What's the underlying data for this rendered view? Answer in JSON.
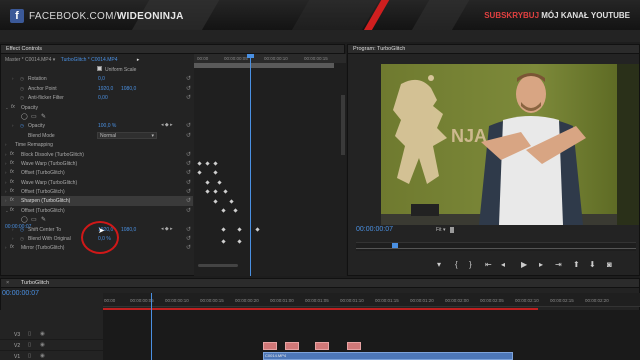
{
  "banner": {
    "fb_prefix": "FACEBOOK.COM/",
    "fb_handle": "WIDEONINJA",
    "yt_strong": "SUBSKRYBUJ",
    "yt_rest": " MÓJ KANAŁ YOUTUBE"
  },
  "effect_controls": {
    "tab_label": "Effect Controls",
    "source_master": "Master * C0014.MP4",
    "source_sequence": "TurboGlitch * C0014.MP4",
    "uniform_scale": "Uniform Scale",
    "timecode": "00:00:00:07",
    "ruler_labels": [
      "00:00",
      "00:00:00:05",
      "00:00:00:10",
      "00:00:00:15"
    ],
    "rows": [
      {
        "label": "Rotation",
        "value": "0,0"
      },
      {
        "label": "Anchor Point",
        "value": "1920,0",
        "value2": "1080,0"
      },
      {
        "label": "Anti-flicker Filter",
        "value": "0,00"
      },
      {
        "label": "Opacity"
      },
      {
        "label": "Opacity",
        "value": "100,0 %"
      },
      {
        "label": "Blend Mode",
        "value": "Normal"
      },
      {
        "label": "Time Remapping"
      },
      {
        "label": "Block Dissolve (TurboGlitch)"
      },
      {
        "label": "Wave Warp (TurboGlitch)"
      },
      {
        "label": "Offset (TurboGlitch)"
      },
      {
        "label": "Wave Warp (TurboGlitch)"
      },
      {
        "label": "Offset (TurboGlitch)"
      },
      {
        "label": "Sharpen (TurboGlitch)"
      },
      {
        "label": "Offset (TurboGlitch)"
      },
      {
        "label": "Shift Center To",
        "value": "1920,0",
        "value2": "1080,0"
      },
      {
        "label": "Blend With Original",
        "value": "0,0 %"
      },
      {
        "label": "Mirror (TurboGlitch)"
      }
    ]
  },
  "program_monitor": {
    "tab_label": "Program: TurboGlitch",
    "timecode": "00:00:00:07",
    "zoom": "Fit",
    "poster_text": "NJA"
  },
  "timeline": {
    "sequence_name": "TurboGlitch",
    "timecode": "00:00:00:07",
    "ruler_labels": [
      "00:00",
      "00:00:00:05",
      "00:00:00:10",
      "00:00:00:15",
      "00:00:00:20",
      "00:00:01:00",
      "00:00:01:05",
      "00:00:01:10",
      "00:00:01:15",
      "00:00:01:20",
      "00:00:02:00",
      "00:00:02:05",
      "00:00:02:10",
      "00:00:02:15",
      "00:00:02:20"
    ],
    "tracks": [
      "V3",
      "V2",
      "V1"
    ],
    "clip_label": "C0014.MP4"
  },
  "colors": {
    "accent_blue": "#4a90e2",
    "annotation_red": "#d01818",
    "banner_red": "#d01f1f",
    "clip_pink": "#c87fc0",
    "clip_blue": "#4d77b8"
  }
}
